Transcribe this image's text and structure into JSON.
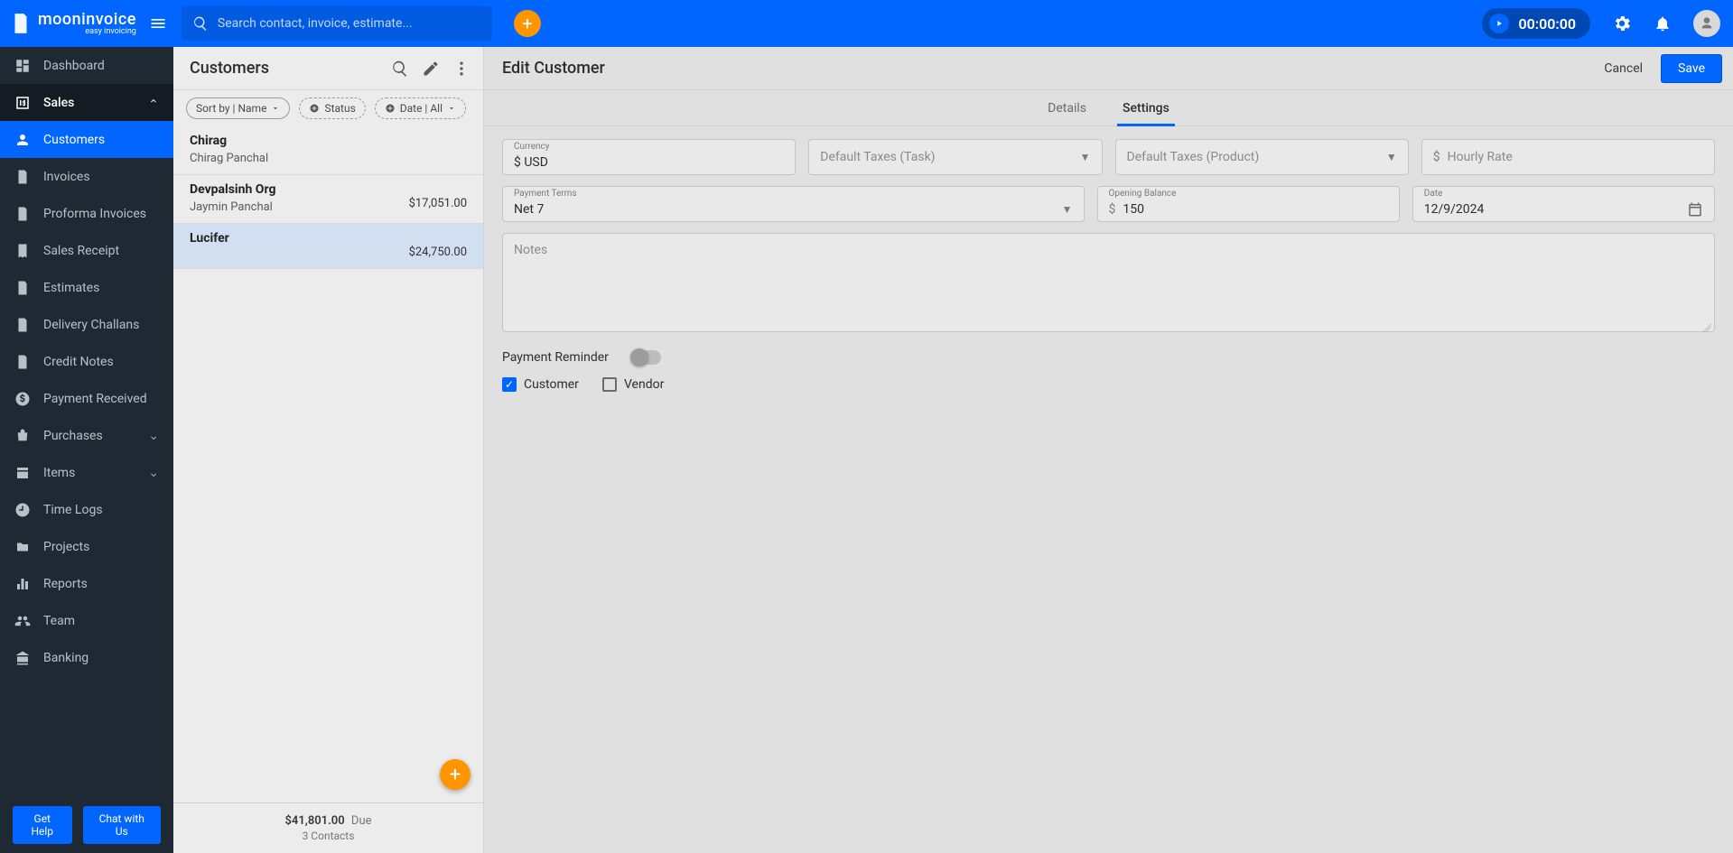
{
  "brand": {
    "name": "mooninvoice",
    "tagline": "easy invoicing"
  },
  "search": {
    "placeholder": "Search contact, invoice, estimate..."
  },
  "timer": "00:00:00",
  "sidebar": {
    "items": [
      {
        "label": "Dashboard"
      },
      {
        "label": "Sales",
        "parent": true
      },
      {
        "label": "Customers",
        "child": true,
        "active": true
      },
      {
        "label": "Invoices",
        "child": true
      },
      {
        "label": "Proforma Invoices",
        "child": true
      },
      {
        "label": "Sales Receipt",
        "child": true
      },
      {
        "label": "Estimates",
        "child": true
      },
      {
        "label": "Delivery Challans",
        "child": true
      },
      {
        "label": "Credit Notes",
        "child": true
      },
      {
        "label": "Payment Received",
        "child": true
      },
      {
        "label": "Purchases",
        "expandable": true
      },
      {
        "label": "Items",
        "expandable": true
      },
      {
        "label": "Time Logs"
      },
      {
        "label": "Projects"
      },
      {
        "label": "Reports"
      },
      {
        "label": "Team"
      },
      {
        "label": "Banking"
      }
    ],
    "help": {
      "get_help": "Get Help",
      "chat": "Chat with Us"
    }
  },
  "customers_panel": {
    "title": "Customers",
    "sort_chip": "Sort by | Name",
    "status_chip": "Status",
    "date_chip": "Date | All",
    "list": [
      {
        "name": "Chirag",
        "sub": "Chirag Panchal",
        "amount": ""
      },
      {
        "name": "Devpalsinh Org",
        "sub": "Jaymin Panchal",
        "amount": "$17,051.00"
      },
      {
        "name": "Lucifer",
        "sub": "",
        "amount": "$24,750.00",
        "selected": true
      }
    ],
    "footer": {
      "total": "$41,801.00",
      "total_suffix": "Due",
      "contacts": "3 Contacts"
    }
  },
  "detail": {
    "title": "Edit Customer",
    "cancel": "Cancel",
    "save": "Save",
    "tabs": {
      "details": "Details",
      "settings": "Settings"
    },
    "form": {
      "currency": {
        "label": "Currency",
        "value": "$ USD"
      },
      "taxes_task": "Default Taxes (Task)",
      "taxes_product": "Default Taxes (Product)",
      "hourly_rate": "Hourly Rate",
      "payment_terms": {
        "label": "Payment Terms",
        "value": "Net 7"
      },
      "opening_balance": {
        "label": "Opening Balance",
        "value": "150"
      },
      "date": {
        "label": "Date",
        "value": "12/9/2024"
      },
      "notes_placeholder": "Notes",
      "payment_reminder": "Payment Reminder",
      "customer_cb": "Customer",
      "vendor_cb": "Vendor"
    }
  }
}
